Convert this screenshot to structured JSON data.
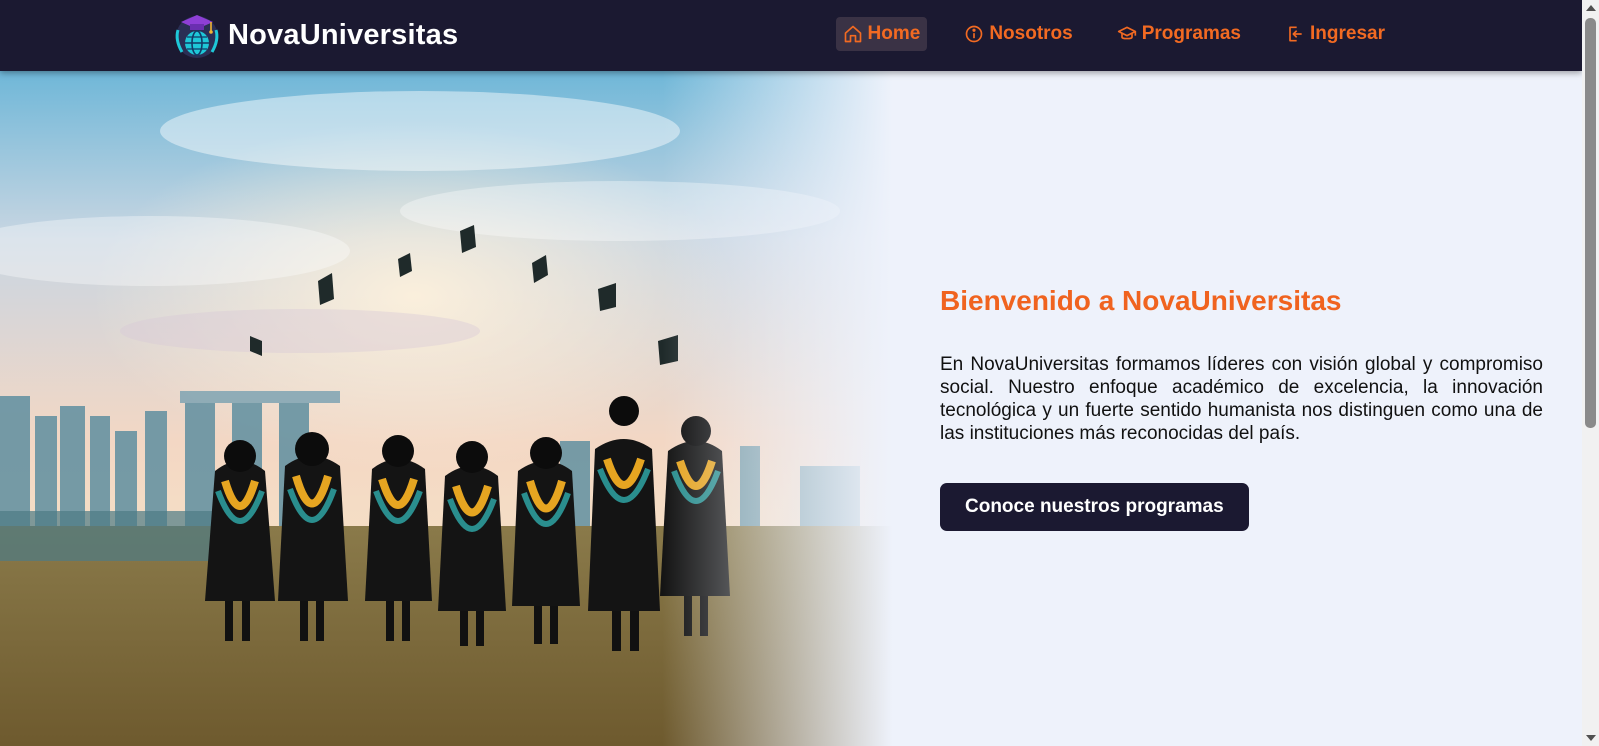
{
  "brand": {
    "name": "NovaUniversitas",
    "logo_icon": "graduation-globe-icon"
  },
  "nav": {
    "items": [
      {
        "label": "Home",
        "icon": "home-icon",
        "active": true
      },
      {
        "label": "Nosotros",
        "icon": "info-icon",
        "active": false
      },
      {
        "label": "Programas",
        "icon": "graduation-cap-icon",
        "active": false
      },
      {
        "label": "Ingresar",
        "icon": "login-icon",
        "active": false
      }
    ]
  },
  "hero": {
    "title": "Bienvenido a NovaUniversitas",
    "text": "En NovaUniversitas formamos líderes con visión global y compromiso social. Nuestro enfoque académico de excelencia, la innovación tecnológica y un fuerte sentido humanista nos distinguen como una de las instituciones más reconocidas del país.",
    "cta_label": "Conoce nuestros programas"
  },
  "colors": {
    "navbar_bg": "#1b1931",
    "accent": "#f26a22",
    "page_bg": "#eef2fb",
    "button_bg": "#1b1931"
  }
}
